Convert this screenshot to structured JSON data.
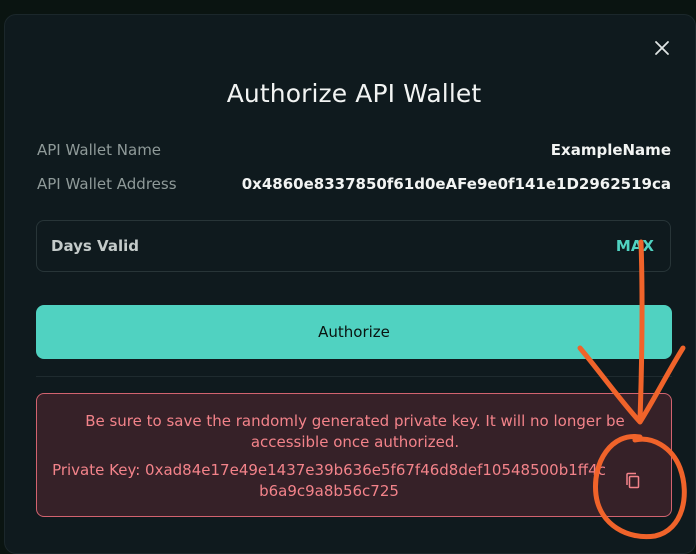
{
  "modal": {
    "title": "Authorize API Wallet",
    "close_icon": "close-icon"
  },
  "details": {
    "name_label": "API Wallet Name",
    "name_value": "ExampleName",
    "address_label": "API Wallet Address",
    "address_value": "0x4860e8337850f61d0eAFe9e0f141e1D2962519ca"
  },
  "days_field": {
    "label": "Days Valid",
    "max_label": "MAX"
  },
  "authorize_button": {
    "label": "Authorize"
  },
  "warning": {
    "message": "Be sure to save the randomly generated private key. It will no longer be accessible once authorized.",
    "private_key": "Private Key: 0xad84e17e49e1437e39b636e5f67f46d8def10548500b1ff4cb6a9c9a8b56c725",
    "copy_icon": "copy-icon"
  },
  "colors": {
    "accent": "#50d2c1",
    "warning_text": "#f3838a",
    "warning_border": "#d2636f",
    "annotation": "#f0632a"
  }
}
